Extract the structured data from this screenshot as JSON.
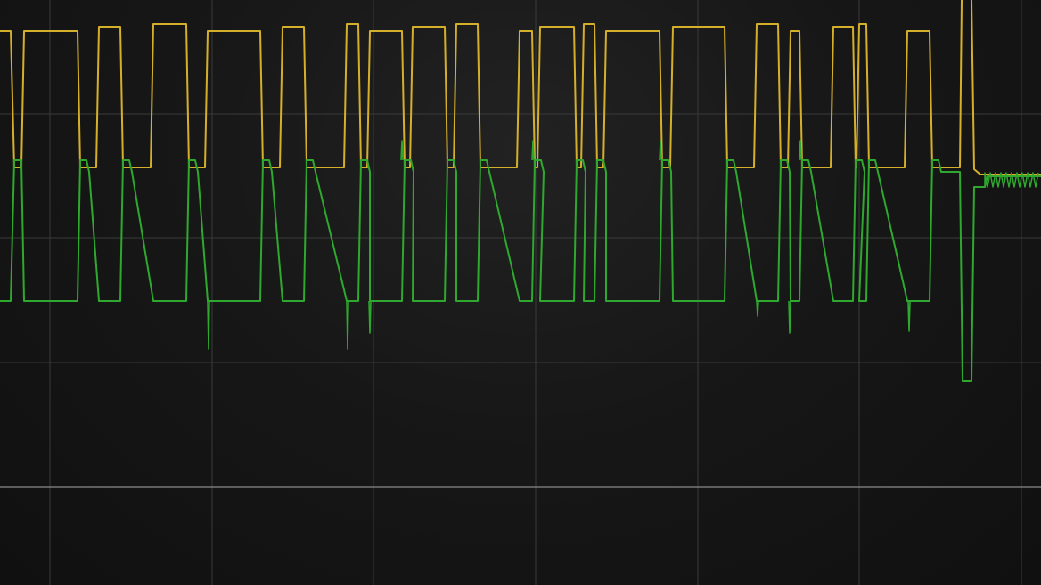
{
  "chart_data": {
    "type": "line",
    "title": "",
    "xlabel": "",
    "ylabel": "",
    "grid": true,
    "grid_divisions": {
      "x": 6.4,
      "y": 4.8
    },
    "x_range": [
      0,
      6.4
    ],
    "y_range": [
      -4.0,
      0.8
    ],
    "colors": {
      "background": "#131313",
      "grid": "#3a3a3a",
      "reference_line": "#8a8a8a",
      "ch1": "#d4b02a",
      "ch2": "#2ea82e"
    },
    "reference_level": -3.0,
    "series": [
      {
        "name": "",
        "color": "#d4b02a",
        "x_div": [
          0,
          0.07,
          0.08,
          0.16,
          0.48,
          0.56,
          0.61,
          0.74,
          0.88,
          0.95,
          1.05,
          1.13,
          1.27,
          1.28,
          1.6,
          1.68,
          1.74,
          1.87,
          2.06,
          2.13,
          2.2,
          2.28,
          2.46,
          2.54,
          2.73,
          2.74,
          2.8,
          2.95,
          3.17,
          3.21,
          3.32,
          3.53,
          3.6,
          3.65,
          3.72,
          3.81,
          3.89,
          4.06,
          4.12,
          4.46,
          4.48,
          4.57,
          4.67,
          4.8,
          4.83,
          4.89,
          5.13,
          5.18,
          5.24,
          5.29,
          5.6,
          5.66,
          5.73,
          5.91,
          5.93,
          5.96,
          6.4
        ],
        "y": [
          0.0,
          0.0,
          -0.81,
          -0.81,
          -0.81,
          -0.81,
          -0.81,
          -0.81,
          -0.81,
          -0.81,
          -0.81,
          -0.81,
          -0.81,
          -0.81,
          -0.81,
          -0.81,
          -0.81,
          -0.81,
          -0.81,
          -0.81,
          -0.81,
          -0.81,
          -0.81,
          -0.81,
          -0.81,
          -0.81,
          -0.81,
          -0.81,
          -0.81,
          -0.81,
          -0.81,
          -0.81,
          -0.81,
          -0.81,
          -0.81,
          -0.81,
          -0.81,
          -0.81,
          -0.81,
          -0.81,
          -0.81,
          -0.81,
          -0.81,
          -0.81,
          -0.81,
          -0.81,
          -0.81,
          -0.81,
          -0.81,
          -0.81,
          -0.81,
          -0.81,
          -0.81,
          -0.81,
          -0.81,
          -0.81,
          -0.81
        ]
      },
      {
        "name": "",
        "color": "#2ea82e",
        "x_div": [
          0,
          6.4
        ],
        "y": [
          -0.81,
          -0.81
        ]
      }
    ],
    "ch1_pulses_div": [
      [
        0.0,
        0.07,
        0.18
      ],
      [
        0.15,
        0.48,
        0.18
      ],
      [
        0.61,
        0.74,
        0.18
      ],
      [
        0.95,
        1.13,
        0.18
      ],
      [
        1.28,
        1.6,
        0.14
      ],
      [
        1.74,
        1.87,
        0.18
      ],
      [
        2.13,
        2.2,
        0.18
      ],
      [
        2.28,
        2.46,
        0.14
      ],
      [
        2.54,
        2.73,
        0.14
      ],
      [
        2.8,
        2.95,
        0.14
      ],
      [
        3.21,
        3.32,
        0.16
      ],
      [
        3.32,
        3.53,
        0.16
      ],
      [
        3.6,
        3.65,
        0.16
      ],
      [
        3.72,
        4.06,
        0.12
      ],
      [
        4.12,
        4.46,
        0.16
      ],
      [
        4.67,
        4.8,
        0.14
      ],
      [
        4.83,
        4.89,
        0.16
      ],
      [
        5.13,
        5.24,
        0.16
      ],
      [
        5.29,
        5.4,
        0.16
      ],
      [
        5.6,
        5.66,
        0.16
      ],
      [
        5.73,
        5.91,
        0.14
      ]
    ],
    "ch2_pulses_div": [
      [
        0.0,
        0.07
      ],
      [
        0.15,
        0.48
      ],
      [
        0.61,
        0.74
      ],
      [
        0.95,
        1.13
      ],
      [
        1.28,
        1.6
      ],
      [
        1.74,
        1.87
      ],
      [
        2.13,
        2.2
      ],
      [
        2.28,
        2.46
      ],
      [
        2.54,
        2.73
      ],
      [
        2.8,
        2.95
      ],
      [
        3.21,
        3.32
      ],
      [
        3.38,
        3.53
      ],
      [
        3.6,
        3.65
      ],
      [
        3.72,
        4.06
      ],
      [
        4.12,
        4.46
      ],
      [
        4.67,
        4.8
      ],
      [
        4.83,
        4.89
      ],
      [
        5.13,
        5.24
      ],
      [
        5.29,
        5.4
      ],
      [
        5.6,
        5.66
      ],
      [
        5.73,
        5.91
      ]
    ],
    "ch2_spikes_div": [
      [
        1.27,
        1.32
      ],
      [
        2.14,
        1.32
      ],
      [
        2.27,
        1.1
      ],
      [
        2.47,
        0.2
      ],
      [
        4.64,
        0.04
      ],
      [
        4.86,
        1.1
      ],
      [
        5.58,
        1.02
      ]
    ],
    "ch1_tail": {
      "x_div": 5.93,
      "high": 1.38,
      "low": 1.0
    },
    "ch2_tail": {
      "x_div": 5.93,
      "dip": -2.22,
      "plateau_div": 6.05,
      "level": -0.81
    }
  }
}
